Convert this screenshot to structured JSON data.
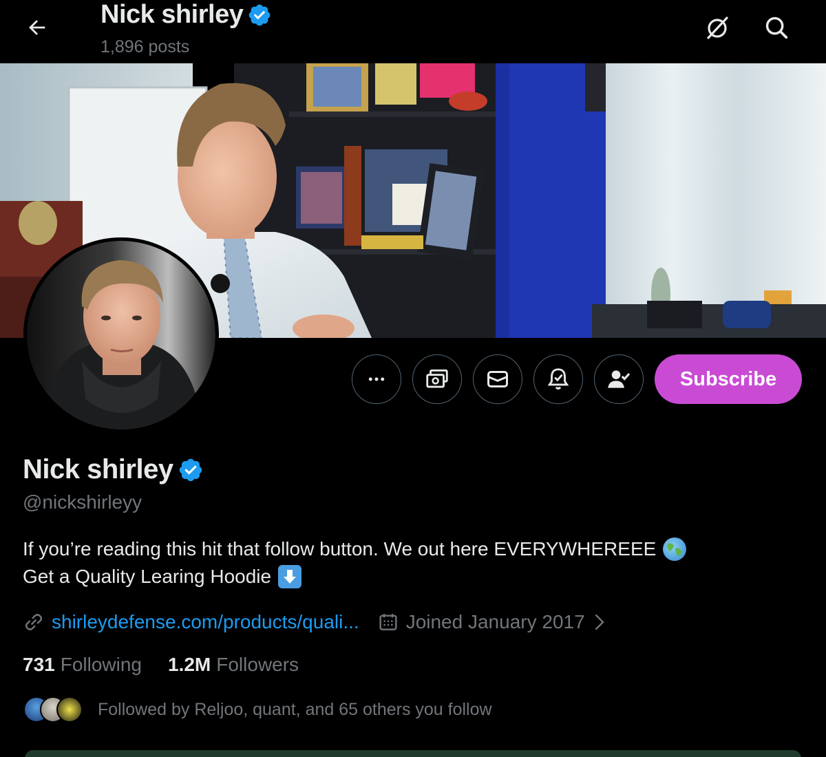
{
  "header": {
    "title": "Nick shirley",
    "posts": "1,896 posts"
  },
  "icons": {
    "back": "arrow-left-icon",
    "grok": "grok-icon",
    "search": "search-icon",
    "more": "more-icon",
    "monetize": "money-icon",
    "message": "mail-icon",
    "notify": "bell-icon",
    "follow": "follow-user-icon",
    "verified": "verified-badge-icon",
    "link": "link-icon",
    "calendar": "calendar-icon"
  },
  "actions": {
    "subscribe_label": "Subscribe"
  },
  "profile": {
    "display_name": "Nick shirley",
    "handle": "@nickshirleyy",
    "bio_line1": "If you’re reading this hit that follow button. We out here EVERYWHEREEE",
    "bio_line2": "Get a Quality Learing Hoodie",
    "website": "shirleydefense.com/products/quali...",
    "joined": "Joined January 2017"
  },
  "stats": {
    "following_count": "731",
    "following_label": "Following",
    "followers_count": "1.2M",
    "followers_label": "Followers"
  },
  "followed_by": "Followed by Reljoo, quant, and 65 others you follow",
  "colors": {
    "background": "#000000",
    "accent_link": "#1d9bf0",
    "subscribe": "#c94bd4",
    "secondary_text": "#71767b",
    "verified": "#1d9bf0"
  }
}
